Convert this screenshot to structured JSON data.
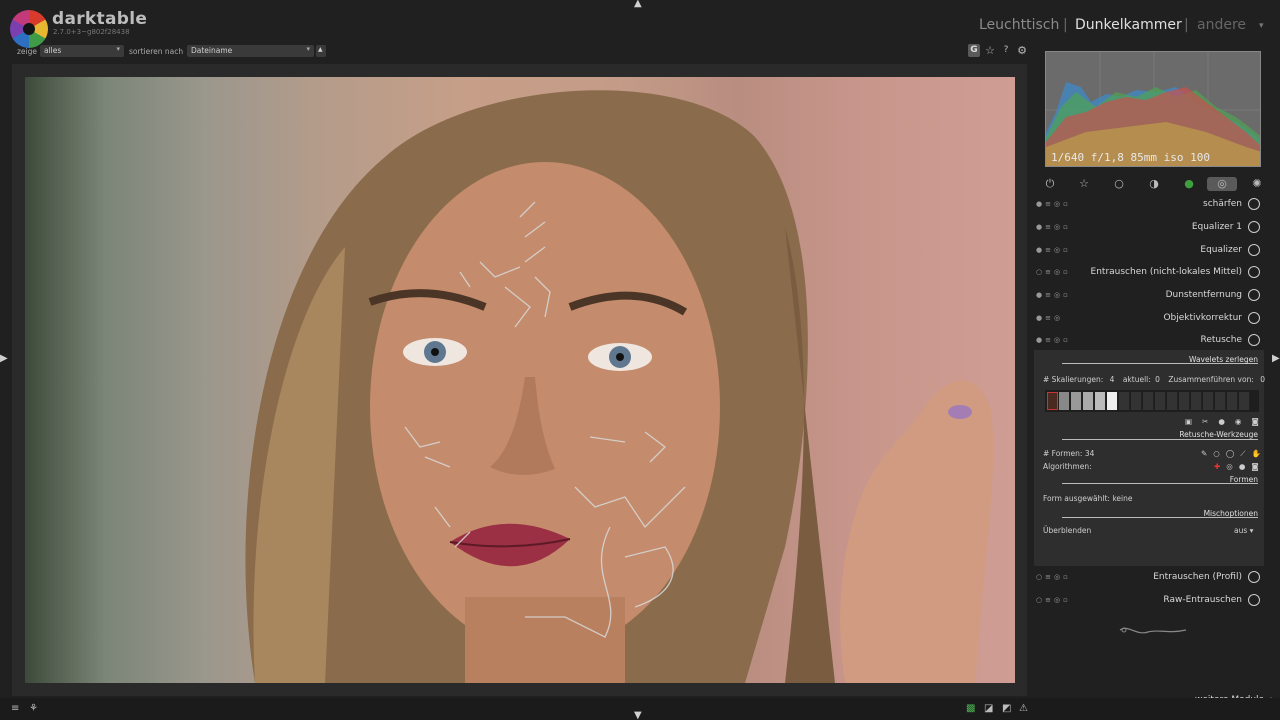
{
  "app": {
    "name": "darktable",
    "version": "2.7.0+3~g802f28438"
  },
  "views": {
    "lighttable": "Leuchttisch",
    "darkroom": "Dunkelkammer",
    "other": "andere",
    "separator": "|"
  },
  "filter_bar": {
    "show_label": "zeige",
    "show_value": "alles",
    "sort_label": "sortieren nach",
    "sort_value": "Dateiname"
  },
  "toolbar_icons": [
    "g-icon",
    "star-icon",
    "help-icon",
    "gear-icon"
  ],
  "toolbar_glyphs": {
    "g": "G",
    "star": "☆",
    "help": "?",
    "gear": "⚙"
  },
  "exif": "1/640 f/1,8 85mm iso 100",
  "module_groups": [
    "power-icon",
    "star-icon",
    "circle-icon",
    "half-circle-icon",
    "color-icon",
    "correct-icon",
    "effect-icon"
  ],
  "modules": [
    {
      "name": "schärfen"
    },
    {
      "name": "Equalizer 1"
    },
    {
      "name": "Equalizer"
    },
    {
      "name": "Entrauschen (nicht-lokales Mittel)"
    },
    {
      "name": "Dunstentfernung"
    },
    {
      "name": "Objektivkorrektur"
    },
    {
      "name": "Retusche"
    }
  ],
  "modules_after": [
    {
      "name": "Entrauschen (Profil)"
    },
    {
      "name": "Raw-Entrauschen"
    }
  ],
  "retouch": {
    "wavelets_title": "Wavelets zerlegen",
    "scales_label": "# Skalierungen:",
    "scales_value": "4",
    "current_label": "aktuell:",
    "current_value": "0",
    "merge_label": "Zusammenführen von:",
    "merge_value": "0",
    "tools_title": "Retusche-Werkzeuge",
    "shapes_label": "# Formen: 34",
    "algorithms_label": "Algorithmen:",
    "shapes_title": "Formen",
    "shape_selected": "Form ausgewählt: keine",
    "blend_title": "Mischoptionen",
    "blend_label": "Überblenden",
    "blend_value": "aus"
  },
  "more_modules": "weitere Module"
}
